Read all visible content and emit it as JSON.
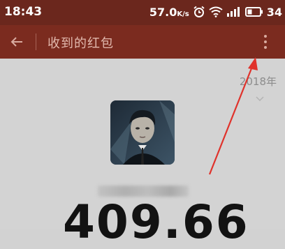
{
  "status_bar": {
    "time": "18:43",
    "network_speed": "57.0",
    "network_speed_unit": "K/s",
    "battery_level": "34"
  },
  "app_bar": {
    "title": "收到的红包"
  },
  "content": {
    "year_selector": "2018年",
    "amount": "409.66"
  },
  "colors": {
    "status_bar_bg": "#6b271d",
    "app_bar_bg": "#7b2b1f",
    "content_bg": "#d3d3d3",
    "annotation_arrow": "#e0322b"
  }
}
